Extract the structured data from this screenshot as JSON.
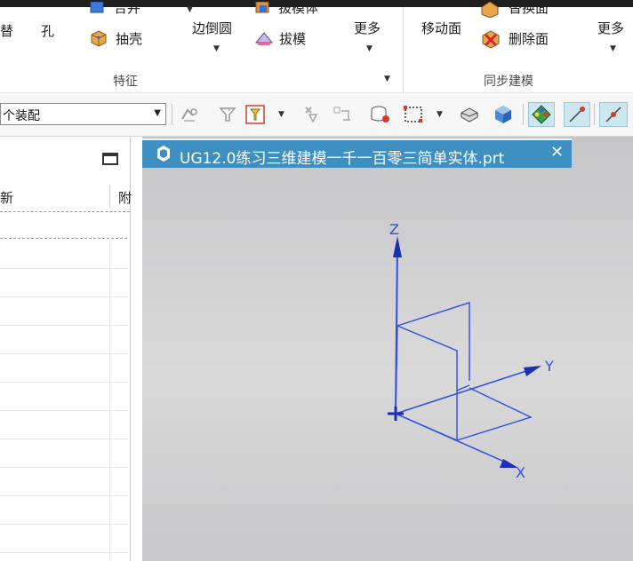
{
  "ribbon": {
    "feature_group": {
      "label": "特征",
      "cut_text": "替",
      "hole": "孔",
      "partial_top": "合并",
      "shell": "抽壳",
      "edge_blend": "边倒圆",
      "partial_top2": "拔模体",
      "draft": "拔模",
      "more": "更多"
    },
    "sync_group": {
      "label": "同步建模",
      "move_face": "移动面",
      "partial_top": "替换面",
      "delete_face": "删除面",
      "more": "更多"
    }
  },
  "toolbar": {
    "assembly_combo": "个装配"
  },
  "navigator": {
    "col_name": "新",
    "col_second": "附"
  },
  "graphics": {
    "tab_title": "UG12.0练习三维建模一千一百零三简单实体.prt",
    "tab_close": "✕",
    "axis_x": "X",
    "axis_y": "Y",
    "axis_z": "Z"
  },
  "colors": {
    "tab_bg": "#3d8ec1",
    "wire": "#2f4fe0",
    "axis_arrow": "#1a2fb8"
  }
}
